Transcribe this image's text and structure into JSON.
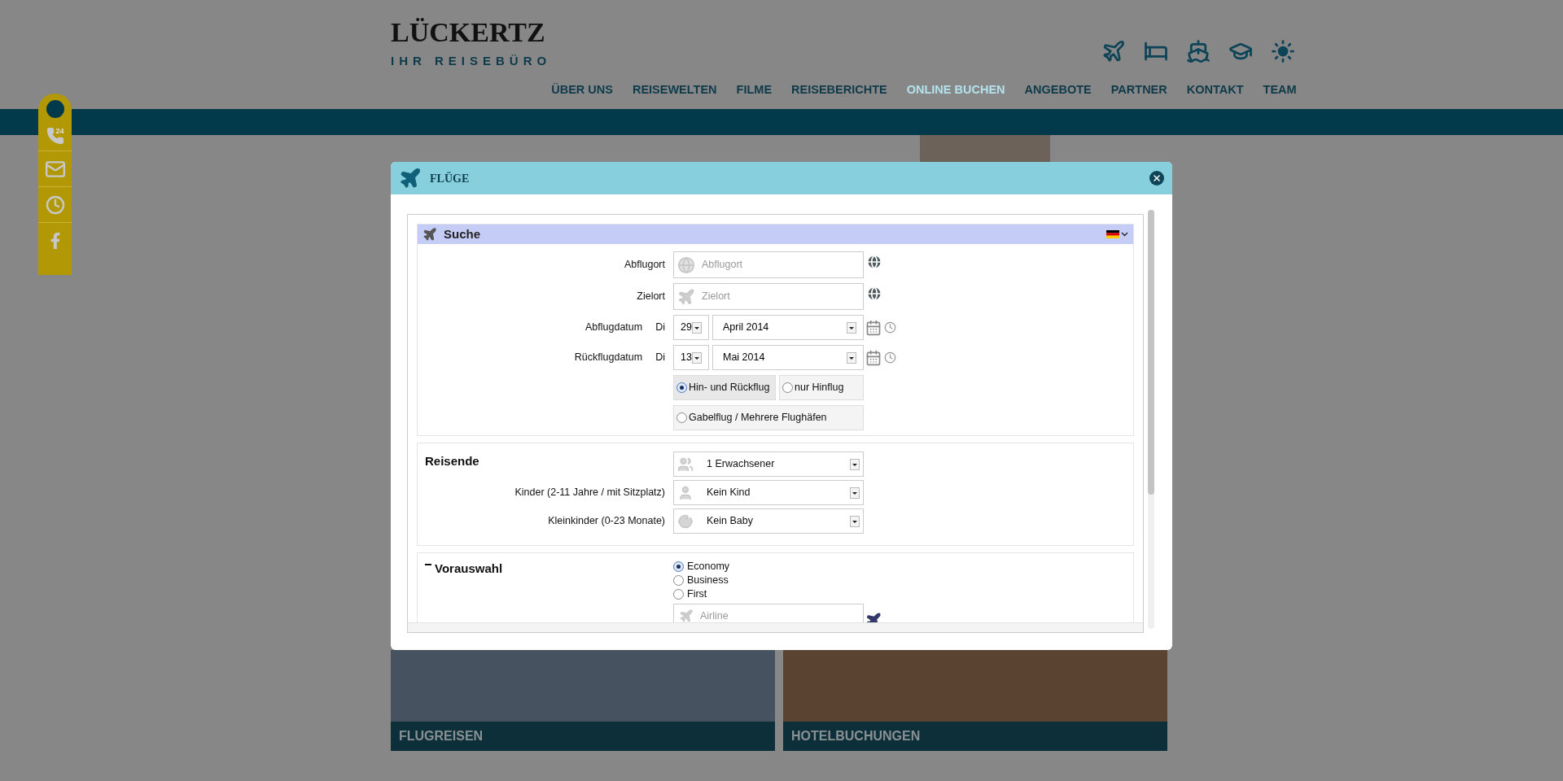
{
  "logo": {
    "wordmark": "LÜCKERTZ",
    "tagline": "IHR REISEBÜRO"
  },
  "sidebar": {
    "phone_badge": "24"
  },
  "nav": [
    {
      "label": "ÜBER UNS",
      "selected": false
    },
    {
      "label": "REISEWELTEN",
      "selected": false
    },
    {
      "label": "FILME",
      "selected": false
    },
    {
      "label": "REISEBERICHTE",
      "selected": false
    },
    {
      "label": "ONLINE BUCHEN",
      "selected": true
    },
    {
      "label": "ANGEBOTE",
      "selected": false
    },
    {
      "label": "PARTNER",
      "selected": false
    },
    {
      "label": "KONTAKT",
      "selected": false
    },
    {
      "label": "TEAM",
      "selected": false
    }
  ],
  "modal": {
    "title": "FLÜGE",
    "search": {
      "title": "Suche",
      "rows": [
        {
          "kind": "origin",
          "label": "Abflugort",
          "placeholder": "Abflugort"
        },
        {
          "kind": "destination",
          "label": "Zielort",
          "placeholder": "Zielort"
        },
        {
          "kind": "date",
          "label": "Abflugdatum",
          "weekday": "Di",
          "day": "29",
          "month": "April 2014"
        },
        {
          "kind": "date",
          "label": "Rückflugdatum",
          "weekday": "Di",
          "day": "13",
          "month": "Mai 2014"
        }
      ],
      "trip_types": [
        {
          "label": "Hin- und Rückflug",
          "selected": true
        },
        {
          "label": "nur Hinflug",
          "selected": false
        },
        {
          "label": "Gabelflug / Mehrere Flughäfen",
          "selected": false
        }
      ]
    },
    "travellers": {
      "title": "Reisende",
      "rows": [
        {
          "kind": "adult",
          "value": "1 Erwachsener"
        },
        {
          "kind": "child",
          "label": "Kinder (2-11 Jahre / mit Sitzplatz)",
          "value": "Kein Kind"
        },
        {
          "kind": "baby",
          "label": "Kleinkinder (0-23 Monate)",
          "value": "Kein Baby"
        }
      ]
    },
    "preselection": {
      "title": "Vorauswahl",
      "expanded": true,
      "classes": [
        {
          "label": "Economy",
          "selected": true
        },
        {
          "label": "Business",
          "selected": false
        },
        {
          "label": "First",
          "selected": false
        }
      ],
      "airline_placeholder": "Airline"
    }
  },
  "cards": [
    {
      "title": "FLUGREISEN"
    },
    {
      "title": "HOTELBUCHUNGEN"
    }
  ]
}
